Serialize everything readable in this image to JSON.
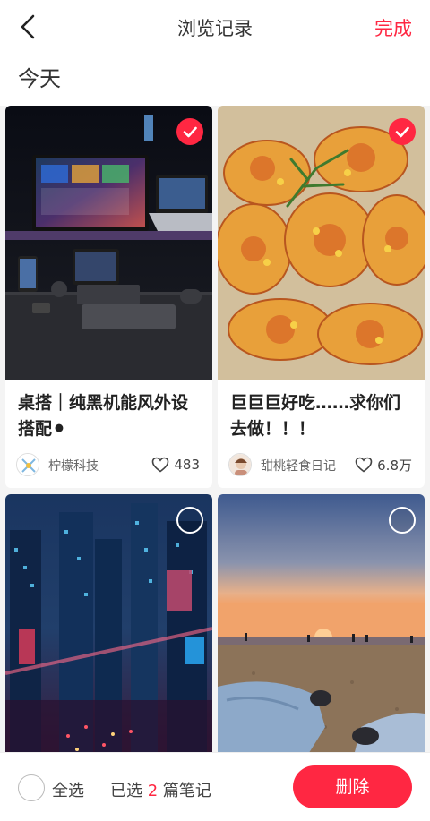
{
  "header": {
    "back_icon": "chevron-left-icon",
    "title": "浏览记录",
    "done_label": "完成"
  },
  "section": {
    "title": "今天"
  },
  "notes": [
    {
      "title": "桌搭｜纯黑机能风外设搭配⚫",
      "author": "柠檬科技",
      "likes": "483",
      "selected": true
    },
    {
      "title": "巨巨巨好吃……求你们去做！！！",
      "author": "甜桃轻食日记",
      "likes": "6.8万",
      "selected": true
    },
    {
      "title": "",
      "author": "",
      "likes": "",
      "selected": false
    },
    {
      "title": "",
      "author": "",
      "likes": "",
      "selected": false
    }
  ],
  "footer": {
    "select_all_label": "全选",
    "selected_prefix": "已选",
    "selected_count": "2",
    "selected_suffix": "篇笔记",
    "delete_label": "删除"
  },
  "colors": {
    "accent": "#ff2742",
    "background": "#f4f4f4"
  }
}
